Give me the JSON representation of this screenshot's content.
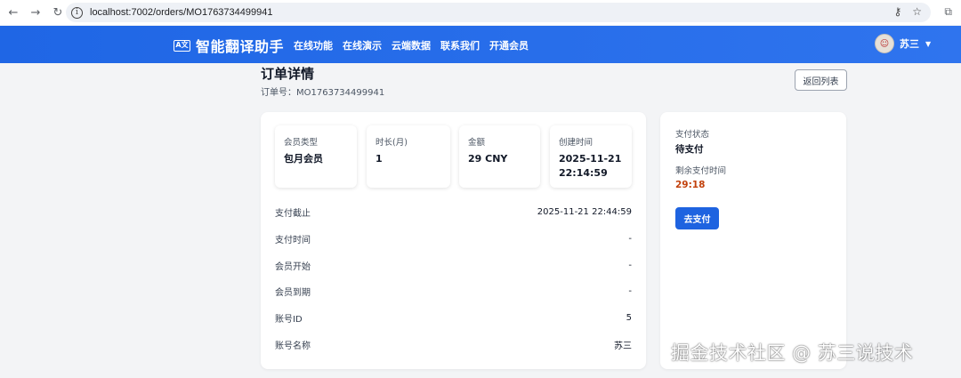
{
  "browser": {
    "url": "localhost:7002/orders/MO1763734499941",
    "icons": [
      "back-arrow",
      "forward-arrow",
      "reload",
      "site-info",
      "password-key",
      "bookmark-star",
      "extensions"
    ]
  },
  "header": {
    "logo_mark": "A文",
    "logo_text": "智能翻译助手",
    "nav": [
      "在线功能",
      "在线演示",
      "云端数据",
      "联系我们",
      "开通会员"
    ],
    "user_name": "苏三"
  },
  "page": {
    "title": "订单详情",
    "order_no": "订单号：MO1763734499941",
    "back_label": "返回列表"
  },
  "summary": [
    {
      "label": "会员类型",
      "value": "包月会员"
    },
    {
      "label": "时长(月)",
      "value": "1"
    },
    {
      "label": "金额",
      "value": "29 CNY"
    },
    {
      "label": "创建时间",
      "value_line1": "2025-11-21",
      "value_line2": "22:14:59"
    }
  ],
  "details": [
    {
      "label": "支付截止",
      "value": "2025-11-21 22:44:59"
    },
    {
      "label": "支付时间",
      "value": "-"
    },
    {
      "label": "会员开始",
      "value": "-"
    },
    {
      "label": "会员到期",
      "value": "-"
    },
    {
      "label": "账号ID",
      "value": "5"
    },
    {
      "label": "账号名称",
      "value": "苏三"
    }
  ],
  "payment": {
    "status_label": "支付状态",
    "status_value": "待支付",
    "remaining_label": "剩余支付时间",
    "remaining_value": "29:18",
    "pay_button": "去支付"
  },
  "watermark": "掘金技术社区 @ 苏三说技术",
  "colors": {
    "header_bg": "#1f66e5",
    "primary_button": "#1e63e0",
    "countdown": "#c2410c",
    "page_bg": "#f3f4f6"
  }
}
